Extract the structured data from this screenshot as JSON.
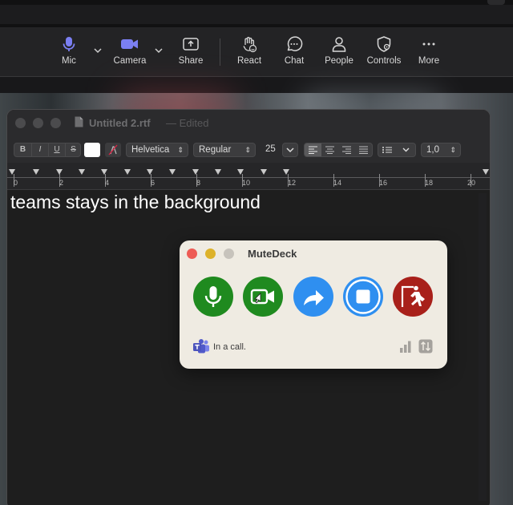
{
  "zoom_toolbar": {
    "items": [
      {
        "label": "Mic",
        "icon": "mic-icon"
      },
      {
        "label": "Camera",
        "icon": "camera-icon"
      },
      {
        "label": "Share",
        "icon": "share-icon"
      },
      {
        "label": "React",
        "icon": "react-icon"
      },
      {
        "label": "Chat",
        "icon": "chat-icon"
      },
      {
        "label": "People",
        "icon": "people-icon"
      },
      {
        "label": "Controls",
        "icon": "controls-icon"
      },
      {
        "label": "More",
        "icon": "more-icon"
      }
    ],
    "accent": "#7b7ff2"
  },
  "textedit": {
    "title": "Untitled 2.rtf",
    "edited": "— Edited",
    "format_bar": {
      "style_buttons": [
        "B",
        "I",
        "U",
        "S"
      ],
      "font_family": "Helvetica",
      "font_style": "Regular",
      "font_size": "25",
      "line_spacing": "1,0"
    },
    "ruler_numbers": [
      "0",
      "2",
      "4",
      "6",
      "8",
      "10",
      "12",
      "14",
      "16",
      "18",
      "20"
    ],
    "content": "teams stays in the background"
  },
  "mutedeck": {
    "title": "MuteDeck",
    "status": "In a call.",
    "buttons": [
      {
        "name": "mute-button",
        "icon": "mic-icon",
        "color": "#1f8a1f"
      },
      {
        "name": "video-button",
        "icon": "video-camera-icon",
        "color": "#1f8a1f"
      },
      {
        "name": "share-button",
        "icon": "share-arrow-icon",
        "color": "#2f8ff0"
      },
      {
        "name": "record-button",
        "icon": "stop-record-icon",
        "color": "#2f8ff0"
      },
      {
        "name": "leave-button",
        "icon": "leave-meeting-icon",
        "color": "#a8201a"
      }
    ],
    "teams_icon": "teams-logo-icon"
  }
}
